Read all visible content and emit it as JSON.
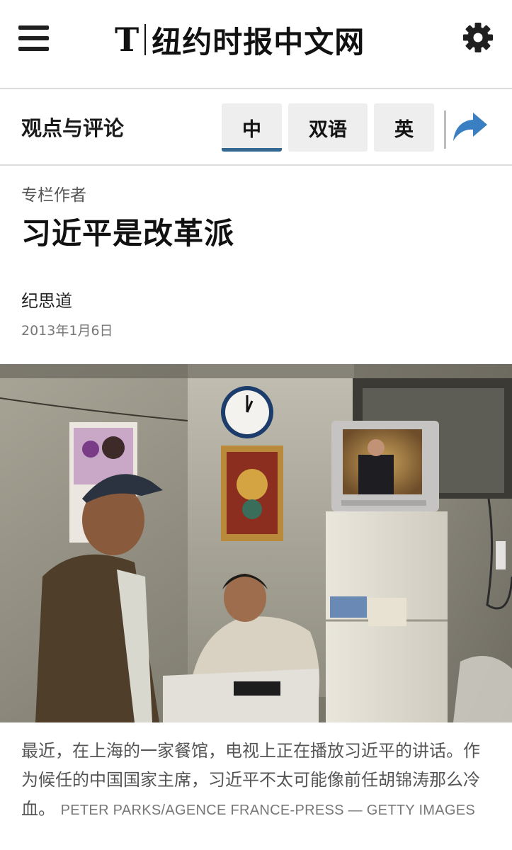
{
  "header": {
    "logo_mark": "T",
    "site_name": "纽约时报中文网",
    "menu_icon": "hamburger-menu-icon",
    "settings_icon": "gear-icon"
  },
  "section": {
    "title": "观点与评论",
    "tabs": [
      {
        "label": "中",
        "active": true
      },
      {
        "label": "双语",
        "active": false
      },
      {
        "label": "英",
        "active": false
      }
    ],
    "share_icon": "share-arrow-icon"
  },
  "article": {
    "kicker": "专栏作者",
    "headline": "习近平是改革派",
    "byline": "纪思道",
    "date": "2013年1月6日"
  },
  "photo": {
    "caption_text": "最近，在上海的一家餐馆，电视上正在播放习近平的讲话。作为候任的中国国家主席，习近平不太可能像前任胡锦涛那么冷血。",
    "credit": "PETER PARKS/AGENCE FRANCE-PRESS — GETTY IMAGES"
  },
  "colors": {
    "accent": "#326891",
    "share": "#3a7fc1",
    "tab_bg": "#eeeeee"
  }
}
